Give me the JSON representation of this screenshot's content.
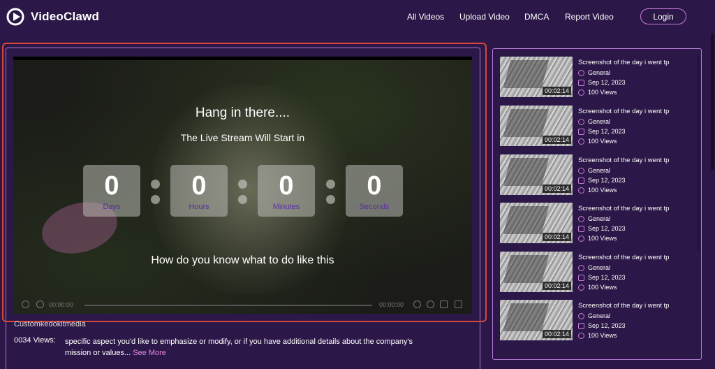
{
  "header": {
    "logo_text": "VideoClawd",
    "nav": [
      "All Videos",
      "Upload Video",
      "DMCA",
      "Report Video"
    ],
    "login_label": "Login"
  },
  "video": {
    "heading": "Hang in there....",
    "subheading": "The Live Stream Will Start in",
    "countdown": [
      {
        "value": "0",
        "label": "Days"
      },
      {
        "value": "0",
        "label": "Hours"
      },
      {
        "value": "0",
        "label": "Minutes"
      },
      {
        "value": "0",
        "label": "Seconds"
      }
    ],
    "stream_title": "How do you know what to do like this",
    "time_current": "00:00:00",
    "time_total": "00:00:00"
  },
  "info": {
    "channel": "Customkedokitmedia",
    "views": "0034 Views:",
    "description": "specific aspect you'd like to emphasize or modify, or if you have additional details about the company's mission or values...",
    "see_more": "See More"
  },
  "sidebar": {
    "items": [
      {
        "title": "Screenshot of the day i went tp",
        "duration": "00:02:14",
        "category": "General",
        "date": "Sep 12, 2023",
        "views": "100 Views"
      },
      {
        "title": "Screenshot of the day i went tp",
        "duration": "00:02:14",
        "category": "General",
        "date": "Sep 12, 2023",
        "views": "100 Views"
      },
      {
        "title": "Screenshot of the day i went tp",
        "duration": "00:02:14",
        "category": "General",
        "date": "Sep 12, 2023",
        "views": "100 Views"
      },
      {
        "title": "Screenshot of the day i went tp",
        "duration": "00:02:14",
        "category": "General",
        "date": "Sep 12, 2023",
        "views": "100 Views"
      },
      {
        "title": "Screenshot of the day i went tp",
        "duration": "00:02:14",
        "category": "General",
        "date": "Sep 12, 2023",
        "views": "100 Views"
      },
      {
        "title": "Screenshot of the day i went tp",
        "duration": "00:02:14",
        "category": "General",
        "date": "Sep 12, 2023",
        "views": "100 Views"
      }
    ]
  },
  "colors": {
    "background": "#2c1848",
    "accent": "#c77ad8",
    "highlight_border": "#d9453a",
    "countdown_label": "#5b2fa0"
  }
}
